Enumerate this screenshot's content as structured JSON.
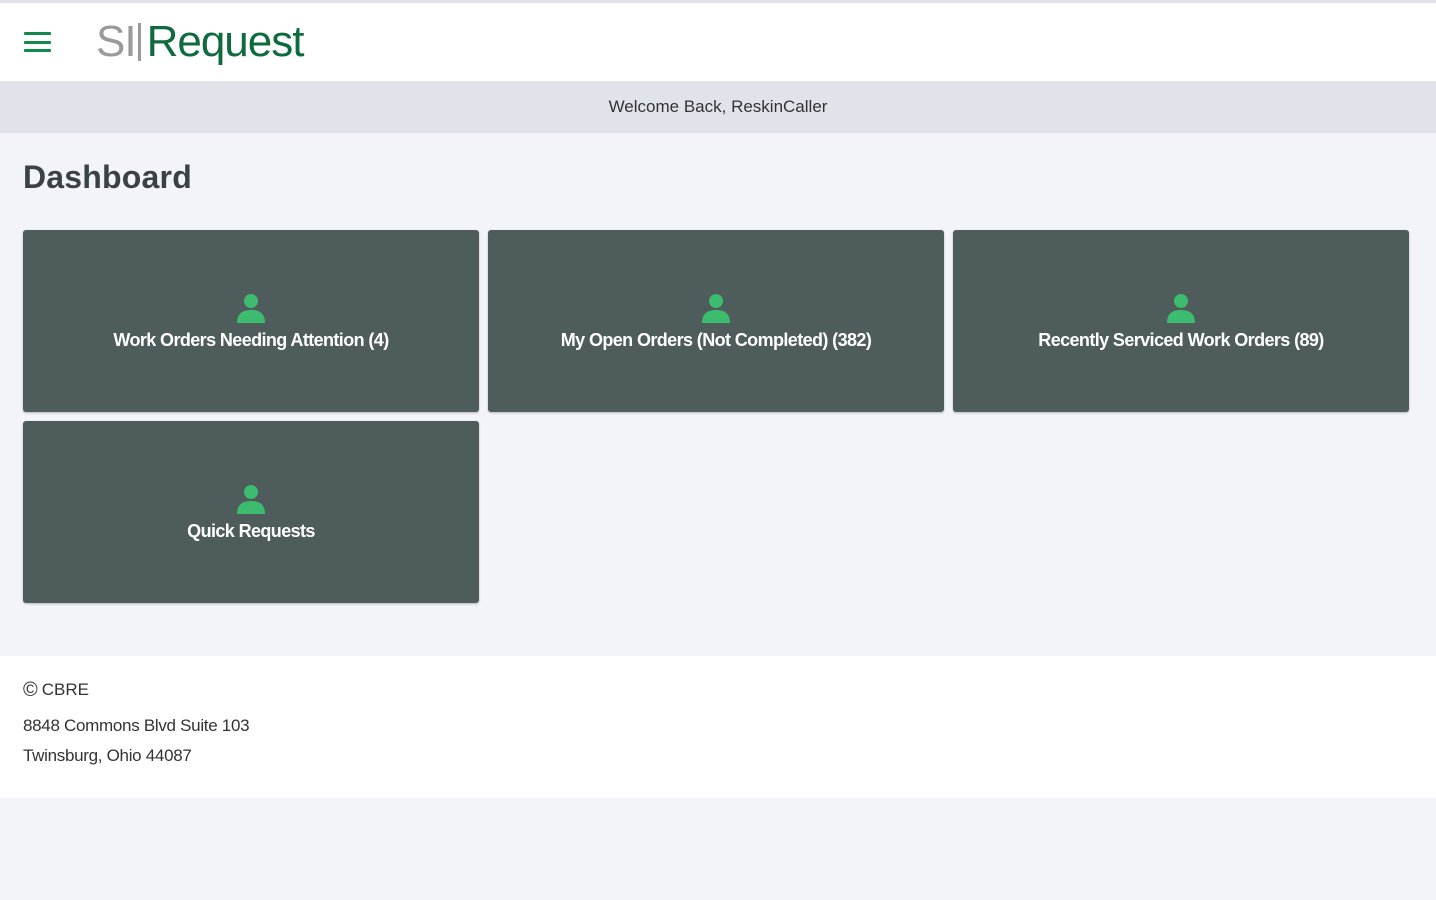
{
  "header": {
    "logo_prefix": "SI",
    "logo_name": "Request",
    "menu_icon": "hamburger-menu-icon",
    "colors": {
      "brand_green": "#0f6b3e",
      "menu_green": "#128a4c",
      "logo_gray": "#9a9a9a"
    }
  },
  "welcome": {
    "text": "Welcome Back, ReskinCaller"
  },
  "main": {
    "title": "Dashboard",
    "tiles": [
      {
        "label": "Work Orders Needing Attention (4)",
        "icon": "user-icon"
      },
      {
        "label": "My Open Orders (Not Completed) (382)",
        "icon": "user-icon"
      },
      {
        "label": "Recently Serviced Work Orders (89)",
        "icon": "user-icon"
      },
      {
        "label": "Quick Requests",
        "icon": "user-icon"
      }
    ],
    "colors": {
      "tile_bg": "#4f5c5c",
      "tile_icon": "#3dbb6e"
    }
  },
  "footer": {
    "copyright_symbol": "©",
    "company": "CBRE",
    "address_line1": "8848 Commons Blvd Suite 103",
    "address_line2": "Twinsburg, Ohio 44087"
  }
}
